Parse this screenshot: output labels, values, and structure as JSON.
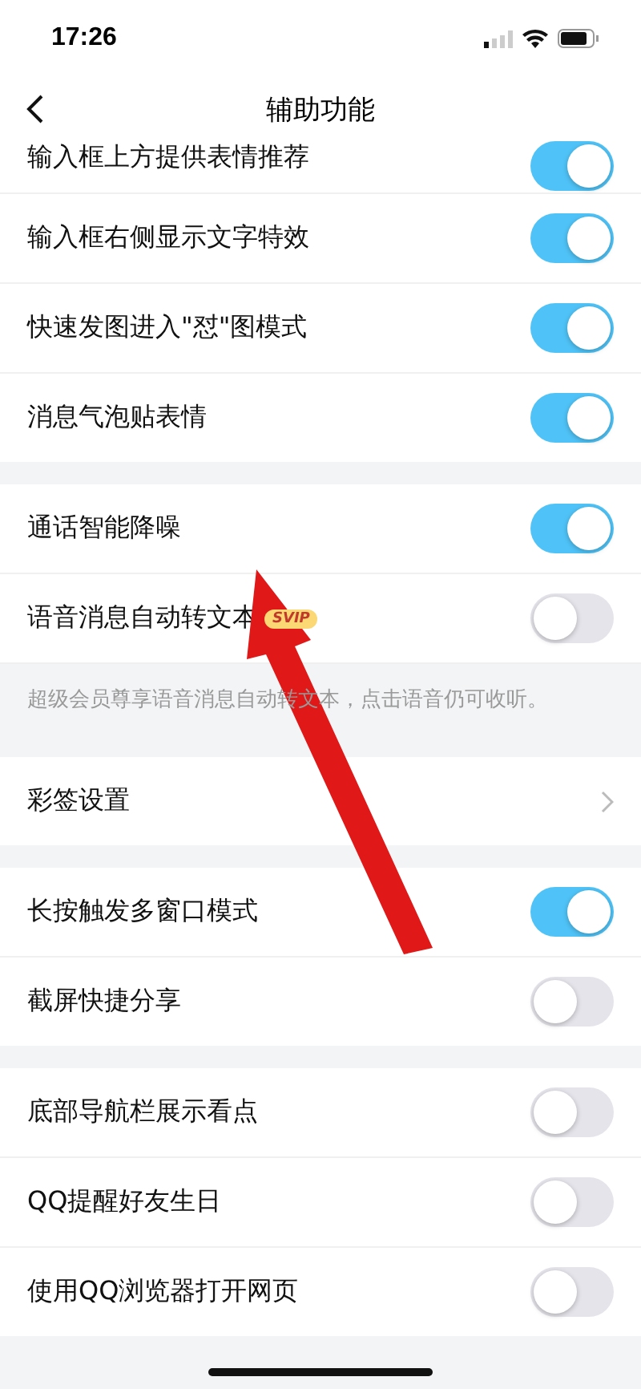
{
  "status_bar": {
    "time": "17:26"
  },
  "nav": {
    "title": "辅助功能"
  },
  "groups": [
    {
      "items": [
        {
          "kind": "toggle",
          "label": "输入框上方提供表情推荐",
          "on": true
        },
        {
          "kind": "toggle",
          "label": "输入框右侧显示文字特效",
          "on": true
        },
        {
          "kind": "toggle",
          "label": "快速发图进入\"怼\"图模式",
          "on": true
        },
        {
          "kind": "toggle",
          "label": "消息气泡贴表情",
          "on": true
        }
      ]
    },
    {
      "items": [
        {
          "kind": "toggle",
          "label": "通话智能降噪",
          "on": true
        },
        {
          "kind": "toggle",
          "label": "语音消息自动转文本",
          "badge": "SVIP",
          "on": false
        }
      ],
      "note": "超级会员尊享语音消息自动转文本，点击语音仍可收听。"
    },
    {
      "items": [
        {
          "kind": "link",
          "label": "彩签设置"
        }
      ]
    },
    {
      "items": [
        {
          "kind": "toggle",
          "label": "长按触发多窗口模式",
          "on": true
        },
        {
          "kind": "toggle",
          "label": "截屏快捷分享",
          "on": false
        }
      ]
    },
    {
      "items": [
        {
          "kind": "toggle",
          "label": "底部导航栏展示看点",
          "on": false
        },
        {
          "kind": "toggle",
          "label": "QQ提醒好友生日",
          "on": false
        },
        {
          "kind": "toggle",
          "label": "使用QQ浏览器打开网页",
          "on": false
        }
      ]
    }
  ]
}
